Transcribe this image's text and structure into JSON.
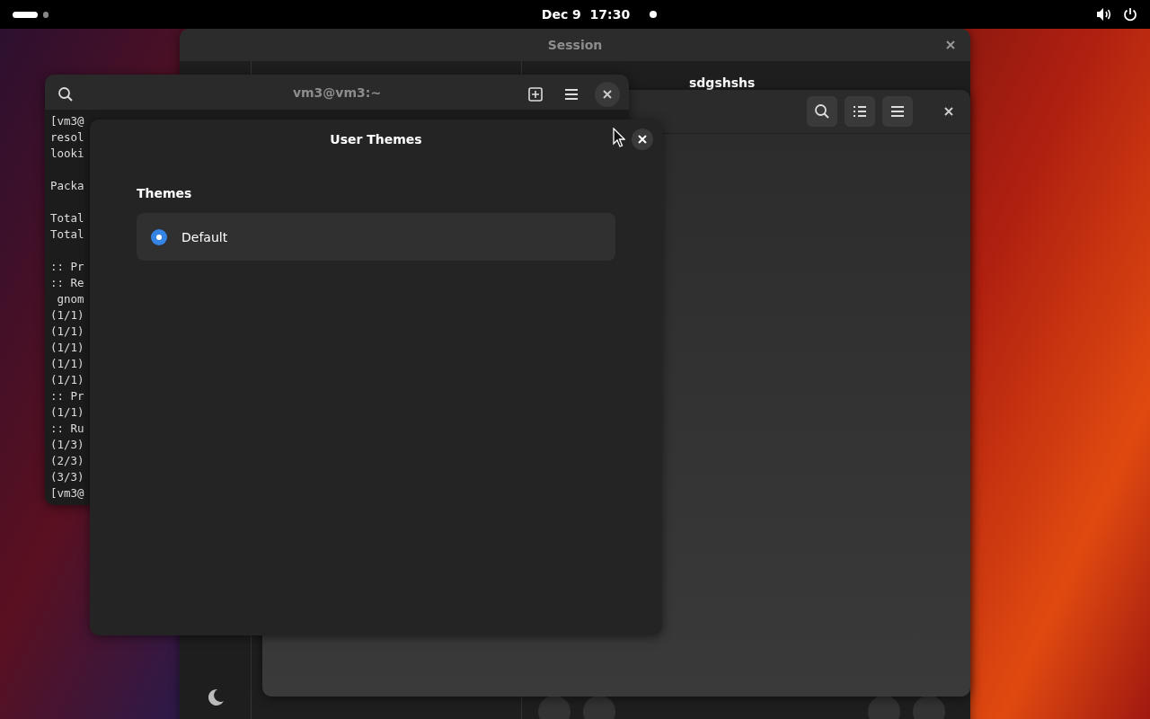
{
  "top_bar": {
    "clock": "Dec 9  17:30",
    "workspaces": [
      {
        "selected": true
      },
      {
        "selected": false
      }
    ]
  },
  "session_window": {
    "title": "Session",
    "profile_name": "sdgshshs"
  },
  "terminal": {
    "title": "vm3@vm3:~",
    "blocks": [
      [
        "[vm3@",
        "resol",
        "looki"
      ],
      [
        "Packa"
      ],
      [
        "Total",
        "Total"
      ],
      [
        ":: Pr",
        ":: Re",
        " gnom",
        "(1/1)",
        "(1/1)",
        "(1/1)",
        "(1/1)",
        "(1/1)",
        ":: Pr",
        "(1/1)",
        ":: Ru",
        "(1/3)",
        "(2/3)",
        "(3/3)",
        "[vm3@"
      ]
    ]
  },
  "dialog": {
    "title": "User Themes",
    "section": "Themes",
    "themes": [
      {
        "label": "Default",
        "selected": true
      }
    ]
  }
}
